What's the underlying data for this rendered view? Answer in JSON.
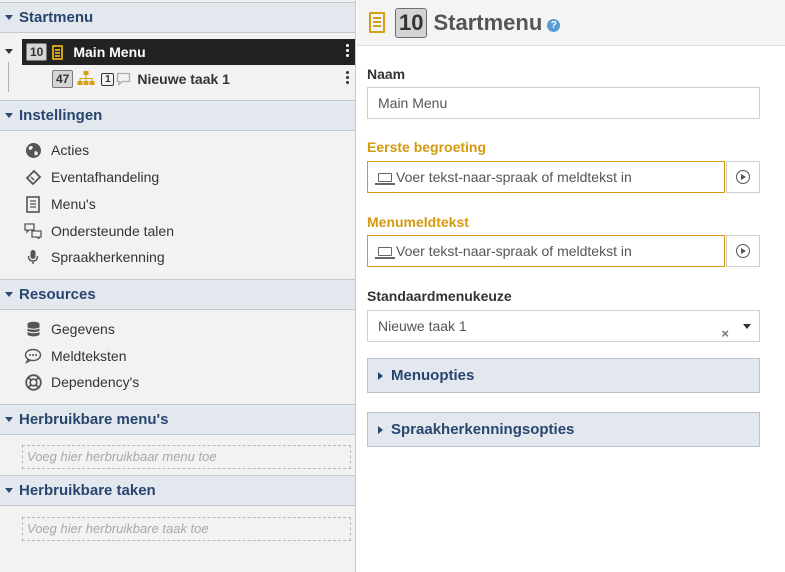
{
  "left": {
    "startmenu": {
      "title": "Startmenu",
      "main_menu": {
        "number": "10",
        "label": "Main Menu"
      },
      "task": {
        "number": "47",
        "sub_number": "1",
        "label": "Nieuwe taak 1"
      }
    },
    "instellingen": {
      "title": "Instellingen",
      "items": [
        {
          "label": "Acties",
          "icon": "globe-icon"
        },
        {
          "label": "Eventafhandeling",
          "icon": "ticket-icon"
        },
        {
          "label": "Menu's",
          "icon": "document-icon"
        },
        {
          "label": "Ondersteunde talen",
          "icon": "language-icon"
        },
        {
          "label": "Spraakherkenning",
          "icon": "microphone-icon"
        }
      ]
    },
    "resources": {
      "title": "Resources",
      "items": [
        {
          "label": "Gegevens",
          "icon": "database-icon"
        },
        {
          "label": "Meldteksten",
          "icon": "speech-bubble-icon"
        },
        {
          "label": "Dependency's",
          "icon": "lifebuoy-icon"
        }
      ]
    },
    "herbruikbare_menus": {
      "title": "Herbruikbare menu's",
      "placeholder": "Voeg hier herbruikbaar menu toe"
    },
    "herbruikbare_taken": {
      "title": "Herbruikbare taken",
      "placeholder": "Voeg hier herbruikbare taak toe"
    }
  },
  "right": {
    "header": {
      "number": "10",
      "title": "Startmenu",
      "help": "?"
    },
    "naam": {
      "label": "Naam",
      "value": "Main Menu"
    },
    "eerste_begroeting": {
      "label": "Eerste begroeting",
      "placeholder": "Voer tekst-naar-spraak of meldtekst in"
    },
    "menumeldtekst": {
      "label": "Menumeldtekst",
      "placeholder": "Voer tekst-naar-spraak of meldtekst in"
    },
    "standaardmenukeuze": {
      "label": "Standaardmenukeuze",
      "value": "Nieuwe taak 1",
      "clear": "×"
    },
    "panels": [
      {
        "title": "Menuopties"
      },
      {
        "title": "Spraakherkenningsopties"
      }
    ]
  },
  "colors": {
    "section_header_bg": "#e3e8ef",
    "section_title": "#28466e",
    "accent_gold": "#d4a017",
    "selected_row_bg": "#222222",
    "warning_label": "#d49a10"
  }
}
